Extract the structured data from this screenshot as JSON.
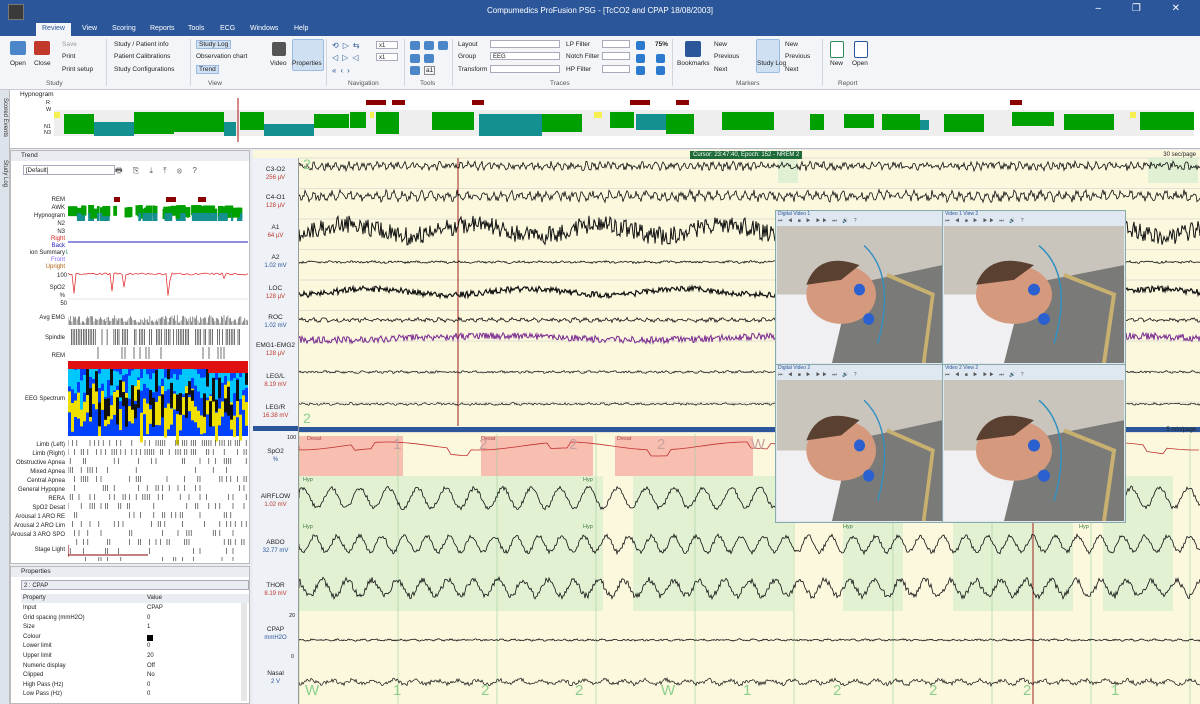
{
  "app": {
    "title": "Compumedics ProFusion PSG - [TcCO2 and CPAP 18/08/2003]",
    "window_buttons": "– ❐ ✕"
  },
  "menu": {
    "items": [
      "Review",
      "View",
      "Scoring",
      "Reports",
      "Tools",
      "ECG",
      "Windows",
      "Help"
    ],
    "active": "Review"
  },
  "ribbon": {
    "study": {
      "open": "Open",
      "close": "Close",
      "save": "Save",
      "print": "Print",
      "print_setup": "Print setup",
      "group": "Study"
    },
    "patient": {
      "info": "Study / Patient info",
      "calibrations": "Patient Calibrations",
      "configurations": "Study Configurations"
    },
    "view": {
      "study_log": "Study Log",
      "observation_chart": "Observation chart",
      "trend": "Trend",
      "video": "Video",
      "properties": "Properties",
      "group": "View"
    },
    "navigation": {
      "zoom1": "x1",
      "zoom2": "x1",
      "group": "Navigation"
    },
    "tools": {
      "group": "Tools",
      "a": "a1"
    },
    "traces": {
      "layout": "Layout",
      "group_label": "Group",
      "group_value": "EEG",
      "transform": "Transform",
      "lp": "LP Filter",
      "notch": "Notch Filter",
      "hp": "HP Filter",
      "group": "Traces",
      "seventy_five": "75%"
    },
    "markers": {
      "bookmarks": "Bookmarks",
      "new": "New",
      "previous": "Previous",
      "next": "Next",
      "study_log": "Study Log",
      "new2": "New",
      "previous2": "Previous",
      "next2": "Next",
      "group": "Markers"
    },
    "report": {
      "new": "New",
      "open": "Open",
      "group": "Report"
    }
  },
  "hypnogram": {
    "title": "Hypnogram",
    "stages": [
      "R",
      "W",
      "N1",
      "N2",
      "N3"
    ]
  },
  "left_tabs": {
    "scored": "Scored Events",
    "study_log": "Study Log"
  },
  "trend": {
    "title": "Trend",
    "preset": "[Default]",
    "labels": {
      "rem": "REM",
      "awk": "AWK",
      "hypnogram": "Hypnogram",
      "n1": "N1",
      "n2": "N2",
      "n3": "N3",
      "right": "Right",
      "back": "Back",
      "position_summary": "ion Summary",
      "left": "Left",
      "front": "Front",
      "upright": "Upright",
      "spo2": "SpO2",
      "pct": "%",
      "spo2_max": "100",
      "spo2_min": "50",
      "avg_emg": "Avg EMG",
      "spindle": "Spindle",
      "rem2": "REM",
      "eeg_spectrum": "EEG Spectrum",
      "limb_left": "Limb (Left)",
      "limb_right": "Limb (Right)",
      "obstructive": "Obstructive Apnea",
      "mixed": "Mixed Apnea",
      "central": "Central Apnea",
      "general_hyp": "General Hypopne",
      "rera": "RERA",
      "spo2_desat": "SpO2 Desat",
      "arousal1": "Arousal 1 ARO RE",
      "arousal2": "Arousal 2 ARO Lim",
      "arousal3": "Arousal 3 ARO SPO",
      "stage_light": "Stage Light"
    }
  },
  "properties": {
    "title": "Properties",
    "selected": "2 : CPAP",
    "col_property": "Property",
    "col_value": "Value",
    "rows": [
      {
        "name": "Input",
        "value": "CPAP"
      },
      {
        "name": "Grid spacing (mmH2O)",
        "value": "0"
      },
      {
        "name": "Size",
        "value": "1"
      },
      {
        "name": "Colour",
        "value": ""
      },
      {
        "name": "Lower limit",
        "value": "0"
      },
      {
        "name": "Upper limit",
        "value": "20"
      },
      {
        "name": "Numeric display",
        "value": "Off"
      },
      {
        "name": "Clipped",
        "value": "No"
      },
      {
        "name": "High Pass (Hz)",
        "value": "0"
      },
      {
        "name": "Low Pass (Hz)",
        "value": "0"
      }
    ]
  },
  "cursor": {
    "text": "Cursor: 23:47:40, Epoch: 152 - NREM 2"
  },
  "eeg_page": "30 sec/page",
  "resp_page": "5 min/page",
  "channels_eeg": [
    {
      "name": "C3-O2",
      "unit": "256 µV"
    },
    {
      "name": "C4-O1",
      "unit": "128 µV"
    },
    {
      "name": "A1",
      "unit": "64 µV"
    },
    {
      "name": "A2",
      "unit": "1.02 mV"
    },
    {
      "name": "LOC",
      "unit": "128 µV"
    },
    {
      "name": "ROC",
      "unit": "1.02 mV"
    },
    {
      "name": "EMG1-EMG2",
      "unit": "128 µV"
    },
    {
      "name": "LEG/L",
      "unit": "8.19 mV"
    },
    {
      "name": "LEG/R",
      "unit": "16.38 mV"
    }
  ],
  "channels_resp": [
    {
      "name": "SpO2",
      "unit": "%"
    },
    {
      "name": "AIRFLOW",
      "unit": "1.02 mV"
    },
    {
      "name": "ABDO",
      "unit": "32.77 mV"
    },
    {
      "name": "THOR",
      "unit": "8.19 mV"
    },
    {
      "name": "CPAP",
      "unit": "mmH2O"
    },
    {
      "name": "Nasal",
      "unit": "2 V"
    }
  ],
  "resp_axis": {
    "spo2_top": "100",
    "cpap_top": "20",
    "cpap_bottom": "0"
  },
  "stage_marks_top": [
    "2",
    "2"
  ],
  "desat_labels": [
    "Desat",
    "Desat",
    "Desat"
  ],
  "resp_stage_marks": [
    "1",
    "2",
    "2",
    "W",
    "2"
  ],
  "bottom_stage_marks": [
    "W",
    "1",
    "2",
    "2",
    "W",
    "1",
    "2",
    "2",
    "2",
    "1"
  ],
  "hyp_label": "Hyp",
  "videos": [
    {
      "title": "Digital Video 1"
    },
    {
      "title": "Video 1 View 2"
    },
    {
      "title": "Digital Video 2"
    },
    {
      "title": "Video 2 View 2"
    }
  ],
  "video_controls": "⏮ ◀ ■ ▶ ▶▶ ⏭ 🔊 ?"
}
